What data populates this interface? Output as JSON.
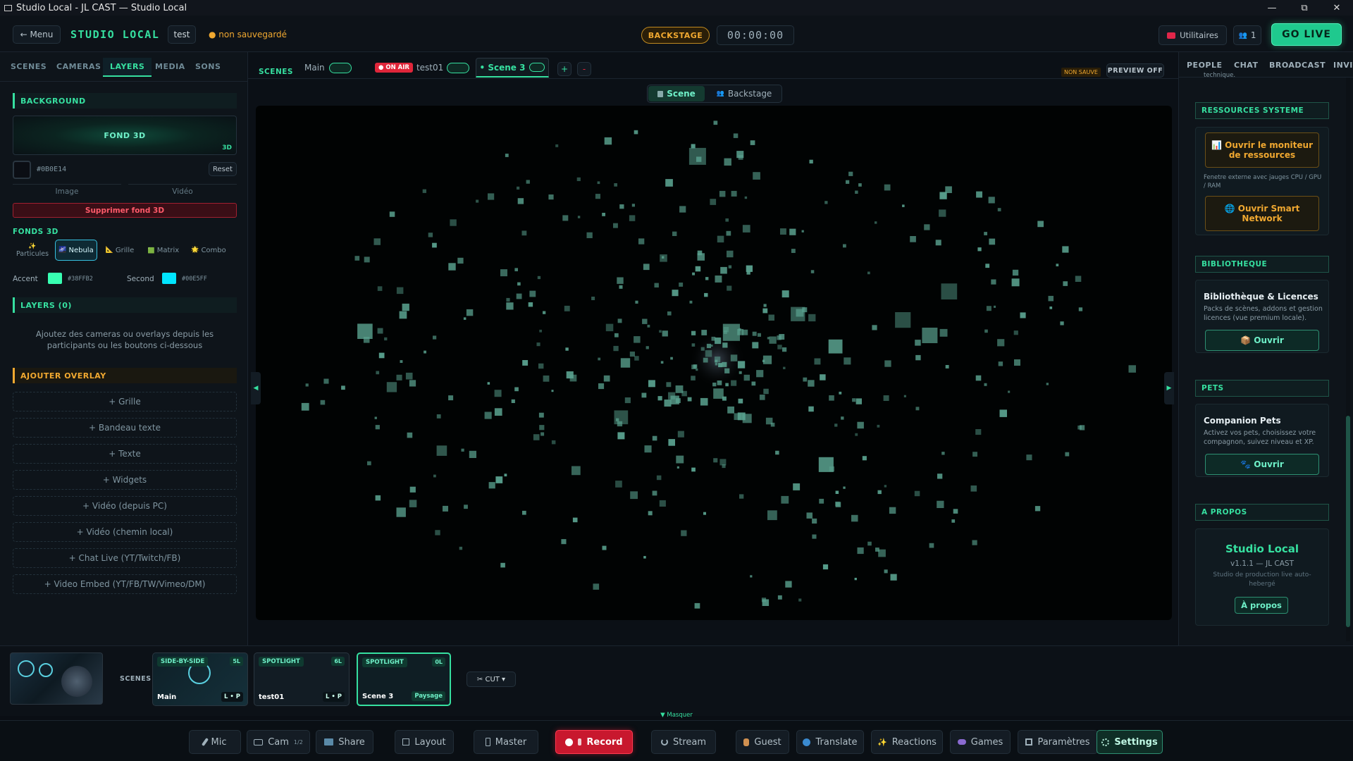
{
  "window": {
    "title": "Studio Local - JL CAST — Studio Local",
    "minimize": "—",
    "maximize": "⧉",
    "close": "✕"
  },
  "header": {
    "menu_label": "← Menu",
    "app_name": "STUDIO LOCAL",
    "project_name": "test",
    "save_status": "● non sauvegardé",
    "backstage_label": "BACKSTAGE",
    "timer": "00:00:00",
    "utilities_label": "Utilitaires",
    "people_count": "1",
    "golive_label": "GO LIVE"
  },
  "left": {
    "tabs": [
      "SCENES",
      "CAMERAS",
      "LAYERS",
      "MEDIA",
      "SONS"
    ],
    "active_tab": "LAYERS",
    "background_title": "BACKGROUND",
    "preview_label": "FOND 3D",
    "preview_badge": "3D",
    "color_value": "#0B0E14",
    "reset_label": "Reset",
    "image_label": "Image",
    "video_label": "Vidéo",
    "delete_label": "Supprimer fond 3D",
    "fonds_title": "FONDS 3D",
    "fonds": [
      {
        "icon": "✨",
        "label": "Particules"
      },
      {
        "icon": "🌌",
        "label": "Nebula"
      },
      {
        "icon": "📐",
        "label": "Grille"
      },
      {
        "icon": "🟩",
        "label": "Matrix"
      },
      {
        "icon": "🌟",
        "label": "Combo"
      }
    ],
    "active_fond": "Nebula",
    "accent_label": "Accent",
    "accent_color": "#38FFB2",
    "accent_hex": "#38FFB2",
    "second_label": "Second",
    "second_color": "#00E5FF",
    "second_hex": "#00E5FF",
    "layers_title": "LAYERS (0)",
    "layers_hint": "Ajoutez des cameras ou overlays depuis les participants ou les boutons ci-dessous",
    "overlay_title": "AJOUTER OVERLAY",
    "overlay_buttons": [
      "+ Grille",
      "+ Bandeau texte",
      "+ Texte",
      "+ Widgets",
      "+ Vidéo (depuis PC)",
      "+ Vidéo (chemin local)",
      "+ Chat Live (YT/Twitch/FB)",
      "+ Video Embed (YT/FB/TW/Vimeo/DM)"
    ]
  },
  "center": {
    "scenes_label": "SCENES",
    "scene_tabs": [
      {
        "name": "Main",
        "onair": ""
      },
      {
        "name": "test01",
        "onair": "● ON AIR"
      },
      {
        "name": "• Scene 3",
        "onair": ""
      }
    ],
    "add_label": "+",
    "remove_label": "-",
    "non_saved_label": "NON SAUVE",
    "preview_off_label": "PREVIEW OFF",
    "view_scene_label": "Scene",
    "view_backstage_label": "Backstage",
    "collapse_left": "◀",
    "collapse_right": "▶",
    "masquer_label": "▼ Masquer"
  },
  "right": {
    "tabs": [
      "PEOPLE",
      "CHAT",
      "BROADCAST",
      "INVIT"
    ],
    "clipped_text": "technique.",
    "resources_title": "RESSOURCES SYSTEME",
    "monitor_label": "📊 Ouvrir le moniteur de ressources",
    "monitor_hint": "Fenetre externe avec jauges CPU / GPU / RAM",
    "network_label": "🌐 Ouvrir Smart Network",
    "library_title": "BIBLIOTHEQUE",
    "library_card_title": "Bibliothèque & Licences",
    "library_card_desc": "Packs de scènes, addons et gestion licences (vue premium locale).",
    "library_button": "📦 Ouvrir",
    "pets_title": "PETS",
    "pets_card_title": "Companion Pets",
    "pets_card_desc": "Activez vos pets, choisissez votre compagnon, suivez niveau et XP.",
    "pets_button": "🐾 Ouvrir",
    "about_title": "A PROPOS",
    "about_app": "Studio Local",
    "about_version": "v1.1.1 — JL CAST",
    "about_desc": "Studio de production live auto-hebergé",
    "about_button": "À propos"
  },
  "scenes_strip": {
    "label": "SCENES",
    "cards": [
      {
        "tag": "SIDE-BY-SIDE",
        "num": "5L",
        "name": "Main",
        "layout": "L • P"
      },
      {
        "tag": "SPOTLIGHT",
        "num": "6L",
        "name": "test01",
        "layout": "L • P"
      },
      {
        "tag": "SPOTLIGHT",
        "num": "0L",
        "name": "Scene 3",
        "layout": "Paysage"
      }
    ],
    "cut_label": "✂ CUT ▾"
  },
  "bottombar": {
    "mic": "Mic",
    "cam": "Cam",
    "cam_count": "1/2",
    "share": "Share",
    "layout": "Layout",
    "master": "Master",
    "record": "Record",
    "stream": "Stream",
    "guest": "Guest",
    "translate": "Translate",
    "reactions": "Reactions",
    "games": "Games",
    "parametres": "Paramètres",
    "settings": "Settings"
  },
  "colors": {
    "accent": "#36e0a0",
    "onair": "#e0263a",
    "record": "#d81b33",
    "warning": "#f0a830"
  }
}
